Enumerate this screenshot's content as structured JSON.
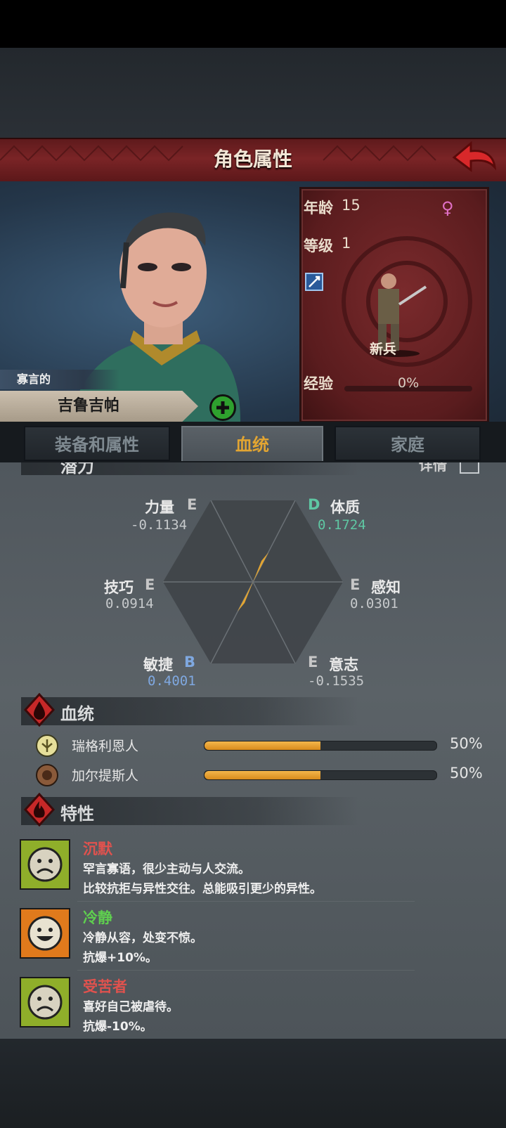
{
  "header": {
    "title": "角色属性"
  },
  "character": {
    "epithet": "寡言的",
    "name": "吉鲁吉帕",
    "age_label": "年龄",
    "age": "15",
    "level_label": "等级",
    "level": "1",
    "class_name": "新兵",
    "exp_label": "经验",
    "exp_value": "0%",
    "exp_fraction": 0
  },
  "tabs": [
    {
      "label": "装备和属性"
    },
    {
      "label": "血统"
    },
    {
      "label": "家庭"
    }
  ],
  "potential": {
    "title": "潜力",
    "details_label": "详情",
    "attributes": [
      {
        "name": "力量",
        "grade": "E",
        "value": "-0.1134"
      },
      {
        "name": "体质",
        "grade": "D",
        "value": "0.1724"
      },
      {
        "name": "技巧",
        "grade": "E",
        "value": "0.0914"
      },
      {
        "name": "感知",
        "grade": "E",
        "value": "0.0301"
      },
      {
        "name": "敏捷",
        "grade": "B",
        "value": "0.4001"
      },
      {
        "name": "意志",
        "grade": "E",
        "value": "-0.1535"
      }
    ]
  },
  "bloodline": {
    "title": "血统",
    "items": [
      {
        "name": "瑞格利恩人",
        "percent": "50%",
        "fraction": 0.5
      },
      {
        "name": "加尔提斯人",
        "percent": "50%",
        "fraction": 0.5
      }
    ]
  },
  "traits": {
    "title": "特性",
    "items": [
      {
        "name": "沉默",
        "line1": "罕言寡语，很少主动与人交流。",
        "line2": "比较抗拒与异性交往。总能吸引更少的异性。",
        "color": "#e0524e",
        "mood": "sad"
      },
      {
        "name": "冷静",
        "line1": "冷静从容，处变不惊。",
        "line2": "抗爆+10%。",
        "color": "#5fcf4f",
        "mood": "happy"
      },
      {
        "name": "受苦者",
        "line1": "喜好自己被虐待。",
        "line2": "抗爆-10%。",
        "color": "#e0524e",
        "mood": "sad"
      }
    ]
  },
  "colors": {
    "accent": "#e2a532",
    "header": "#7a2426",
    "grade_d": "#5fc7a3",
    "grade_b": "#7fa8e0"
  }
}
